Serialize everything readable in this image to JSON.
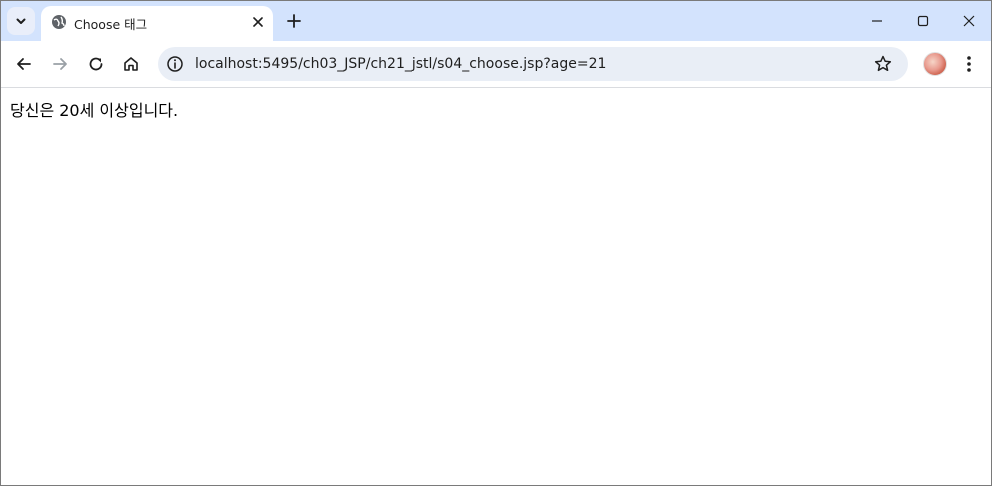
{
  "browser": {
    "tab": {
      "title": "Choose 태그",
      "favicon": "globe-icon"
    },
    "new_tab_icon": "plus-icon",
    "window_controls": [
      "minimize-icon",
      "maximize-icon",
      "close-icon"
    ],
    "toolbar": {
      "back_icon": "back-arrow-icon",
      "forward_icon": "forward-arrow-icon",
      "reload_icon": "reload-icon",
      "home_icon": "home-icon",
      "url": "localhost:5495/ch03_JSP/ch21_jstl/s04_choose.jsp?age=21",
      "site_info_icon": "info-icon",
      "bookmark_icon": "star-icon",
      "menu_icon": "kebab-menu-icon"
    },
    "accent_color": "#d3e3fd"
  },
  "page": {
    "message": "당신은 20세 이상입니다."
  }
}
